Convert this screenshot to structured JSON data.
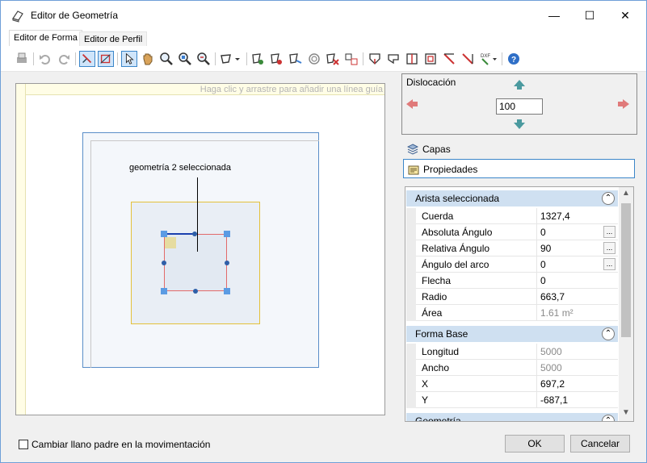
{
  "window": {
    "title": "Editor de Geometría",
    "controls": {
      "minimize": "—",
      "maximize": "☐",
      "close": "✕"
    }
  },
  "tabs": [
    {
      "label": "Editor de Forma",
      "active": true
    },
    {
      "label": "Editor de Perfil",
      "active": false
    }
  ],
  "toolbar": {
    "icons": [
      "print-icon",
      "undo-icon",
      "redo-icon",
      "select-edge-icon",
      "select-shape-icon",
      "pointer-icon",
      "pan-hand-icon",
      "zoom-in-icon",
      "zoom-window-icon",
      "zoom-fit-icon",
      "polygon-dropdown-icon",
      "add-vertex-icon",
      "remove-vertex-icon",
      "rotate-icon",
      "offset-icon",
      "delete-icon",
      "move-icon",
      "shape-icon-1",
      "shape-icon-2",
      "shape-icon-3",
      "shape-icon-4",
      "cut-icon-1",
      "cut-icon-2",
      "dxf-import-icon",
      "help-icon"
    ]
  },
  "canvas": {
    "guide_hint": "Haga clic y arrastre para añadir una línea guía",
    "label": "geometría 2 seleccionada"
  },
  "dislocacion": {
    "title": "Dislocación",
    "value": "100"
  },
  "panels": {
    "capas": "Capas",
    "propiedades": "Propiedades"
  },
  "properties": {
    "section1": {
      "title": "Arista seleccionada",
      "rows": [
        {
          "name": "Cuerda",
          "value": "1327,4"
        },
        {
          "name": "Absoluta Ángulo",
          "value": "0"
        },
        {
          "name": "Relativa Ángulo",
          "value": "90"
        },
        {
          "name": "Ángulo del arco",
          "value": "0"
        },
        {
          "name": "Flecha",
          "value": "0"
        },
        {
          "name": "Radio",
          "value": "663,7"
        },
        {
          "name": "Área",
          "value": "1.61 m²"
        }
      ]
    },
    "section2": {
      "title": "Forma Base",
      "rows": [
        {
          "name": "Longitud",
          "value": "5000"
        },
        {
          "name": "Ancho",
          "value": "5000"
        },
        {
          "name": "X",
          "value": "697,2"
        },
        {
          "name": "Y",
          "value": "-687,1"
        }
      ]
    },
    "section3": {
      "title": "Geometría"
    }
  },
  "footer": {
    "checkbox_label": "Cambiar llano padre en la movimentación",
    "ok": "OK",
    "cancel": "Cancelar"
  }
}
